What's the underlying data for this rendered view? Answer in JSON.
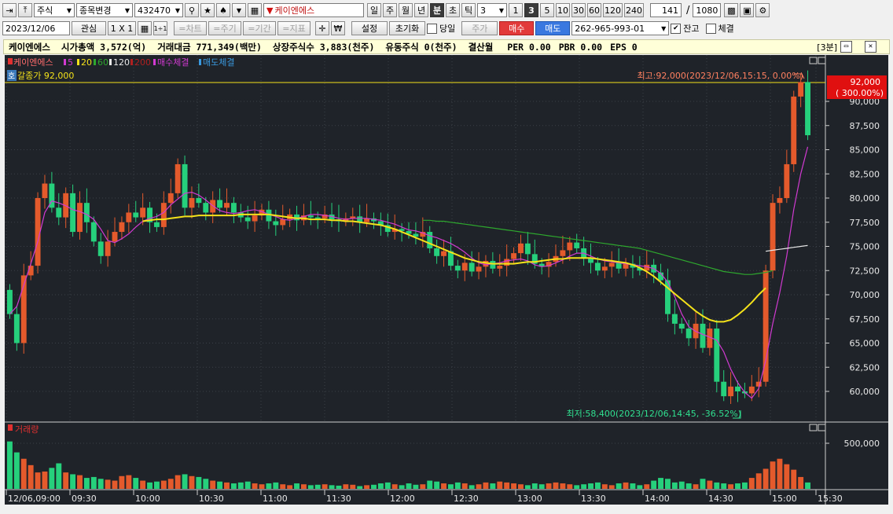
{
  "toolbar1": {
    "market": "주식",
    "change_label": "종목변경",
    "code": "432470",
    "stock_name": "케이엔에스",
    "periods": [
      "일",
      "주",
      "월",
      "년",
      "분",
      "초",
      "틱"
    ],
    "selected_period": "분",
    "interval_value": "3",
    "interval_buttons": [
      "1",
      "3",
      "5",
      "10",
      "30",
      "60",
      "120",
      "240"
    ],
    "selected_interval": "3",
    "count": "141",
    "count_sep": "/",
    "total": "1080"
  },
  "toolbar2": {
    "date": "2023/12/06",
    "watch": "관심",
    "layout": "1 X 1",
    "layout_mini": "1÷1",
    "chart_btn": "=차트",
    "period_btn": "=주기",
    "range_btn": "=기간",
    "indicator_btn": "=지표",
    "settings": "설정",
    "reset": "초기화",
    "today": "당일",
    "price_type": "주가",
    "buy": "매수",
    "sell": "매도",
    "account": "262-965-993-01",
    "balance": "잔고",
    "fills": "체결"
  },
  "info": {
    "name": "케이엔에스",
    "market_cap": "시가총액 3,572(억)",
    "trade_value": "거래대금 771,349(백만)",
    "listed_shares": "상장주식수 3,883(천주)",
    "float_shares": "유동주식 0(천주)",
    "settlement": "결산월",
    "per": "PER 0.00",
    "pbr": "PBR 0.00",
    "eps": "EPS 0",
    "frame": "[3분]"
  },
  "legend": {
    "name": "케이엔에스",
    "ma5": "5",
    "ma20": "20",
    "ma60": "60",
    "ma120": "120",
    "ma200": "200",
    "buy_fill": "매수체결",
    "sell_fill": "매도체결",
    "hoga_icon": "호",
    "limit_text": "갈종가 92,000",
    "volume_label": "거래량"
  },
  "colors": {
    "up": "#e45a2c",
    "down": "#26d07c",
    "ma5": "#d13ad1",
    "ma20": "#f4e21a",
    "ma60": "#2ea82e",
    "ma120": "#e8e8e8",
    "background": "#1f2329",
    "price_badge": "#e01010"
  },
  "annotations": {
    "high": "최고:92,000(2023/12/06,15:15, 0.00%)",
    "low": "최저:58,400(2023/12/06,14:45, -36.52%)"
  },
  "price_badge": {
    "price": "92,000",
    "pct": "( 300.00%)"
  },
  "chart_data": {
    "type": "candlestick",
    "price_axis": {
      "ticks": [
        "90,000",
        "87,500",
        "85,000",
        "82,500",
        "80,000",
        "77,500",
        "75,000",
        "72,500",
        "70,000",
        "67,500",
        "65,000",
        "62,500",
        "60,000"
      ],
      "tick_values": [
        90000,
        87500,
        85000,
        82500,
        80000,
        77500,
        75000,
        72500,
        70000,
        67500,
        65000,
        62500,
        60000
      ]
    },
    "volume_axis": {
      "ticks": [
        "500,000"
      ],
      "tick_values": [
        500000
      ]
    },
    "time_labels": [
      "12/06,09:00",
      "09:30",
      "10:00",
      "10:30",
      "11:00",
      "11:30",
      "12:00",
      "12:30",
      "13:00",
      "13:30",
      "14:00",
      "14:30",
      "15:00",
      "15:30"
    ],
    "series": [
      {
        "name": "5",
        "values": [
          68000,
          68800,
          71000,
          73200,
          75500,
          78500,
          79700,
          79500,
          79200,
          78800,
          78600,
          78300,
          77800,
          76800,
          75600,
          75400,
          75800,
          76300,
          77000,
          77600,
          77900,
          78100,
          78500,
          79300,
          79900,
          80500,
          80600,
          80300,
          79800,
          79200,
          78700,
          78500,
          78400,
          78500,
          78700,
          78800,
          78600,
          78300,
          78100,
          77800,
          77700,
          77900,
          78100,
          78300,
          78300,
          78200,
          78100,
          77900,
          77800,
          77900,
          77900,
          77900,
          77800,
          77700,
          77500,
          77300,
          77000,
          76700,
          76600,
          76400,
          76100,
          75900,
          75600,
          75300,
          74900,
          74400,
          73800,
          73300,
          73100,
          73200,
          73300,
          73500,
          73600,
          73700,
          73500,
          73100,
          72900,
          73000,
          73300,
          73600,
          74000,
          74300,
          74300,
          74000,
          73700,
          73500,
          73400,
          73300,
          73200,
          73100,
          73000,
          72900,
          72700,
          72200,
          71300,
          69800,
          68000,
          66700,
          66200,
          65900,
          65600,
          65300,
          64100,
          62300,
          60900,
          59900,
          59300,
          60300,
          63200,
          67000,
          70200,
          74000,
          78800,
          82500,
          85300
        ]
      },
      {
        "name": "20",
        "values": [
          null,
          null,
          null,
          null,
          null,
          null,
          null,
          null,
          null,
          null,
          null,
          null,
          null,
          null,
          null,
          null,
          null,
          null,
          null,
          77600,
          77700,
          77800,
          77800,
          77900,
          78000,
          78100,
          78100,
          78200,
          78200,
          78200,
          78200,
          78200,
          78200,
          78300,
          78300,
          78300,
          78300,
          78300,
          78200,
          78100,
          78000,
          77900,
          77900,
          77800,
          77800,
          77800,
          77700,
          77700,
          77600,
          77600,
          77500,
          77400,
          77300,
          77200,
          77000,
          76800,
          76500,
          76200,
          75900,
          75600,
          75300,
          75000,
          74700,
          74400,
          74100,
          73800,
          73600,
          73400,
          73300,
          73200,
          73200,
          73200,
          73200,
          73300,
          73400,
          73400,
          73500,
          73600,
          73700,
          73700,
          73800,
          73800,
          73800,
          73800,
          73700,
          73600,
          73500,
          73400,
          73300,
          73100,
          72800,
          72400,
          71900,
          71300,
          70700,
          70100,
          69500,
          68900,
          68300,
          67800,
          67400,
          67200,
          67200,
          67400,
          67900,
          68500,
          69200,
          70000,
          70700
        ]
      },
      {
        "name": "60",
        "values": [
          null,
          null,
          null,
          null,
          null,
          null,
          null,
          null,
          null,
          null,
          null,
          null,
          null,
          null,
          null,
          null,
          null,
          null,
          null,
          null,
          null,
          null,
          null,
          null,
          null,
          null,
          null,
          null,
          null,
          null,
          null,
          null,
          null,
          null,
          null,
          null,
          null,
          null,
          null,
          null,
          null,
          null,
          null,
          null,
          null,
          null,
          null,
          null,
          null,
          null,
          null,
          null,
          null,
          null,
          null,
          null,
          null,
          null,
          null,
          77700,
          77700,
          77600,
          77600,
          77500,
          77400,
          77300,
          77200,
          77100,
          77000,
          76900,
          76800,
          76700,
          76600,
          76500,
          76400,
          76300,
          76200,
          76100,
          76000,
          75900,
          75800,
          75700,
          75600,
          75500,
          75400,
          75300,
          75200,
          75100,
          75000,
          74900,
          74800,
          74600,
          74400,
          74200,
          74000,
          73800,
          73600,
          73400,
          73200,
          73000,
          72800,
          72600,
          72400,
          72300,
          72200,
          72100,
          72100,
          72200,
          72300,
          72500
        ]
      },
      {
        "name": "120",
        "values": [
          74500,
          74600,
          74700,
          74800,
          74900,
          75000,
          75100
        ]
      }
    ],
    "high": 92000,
    "low": 58400
  }
}
